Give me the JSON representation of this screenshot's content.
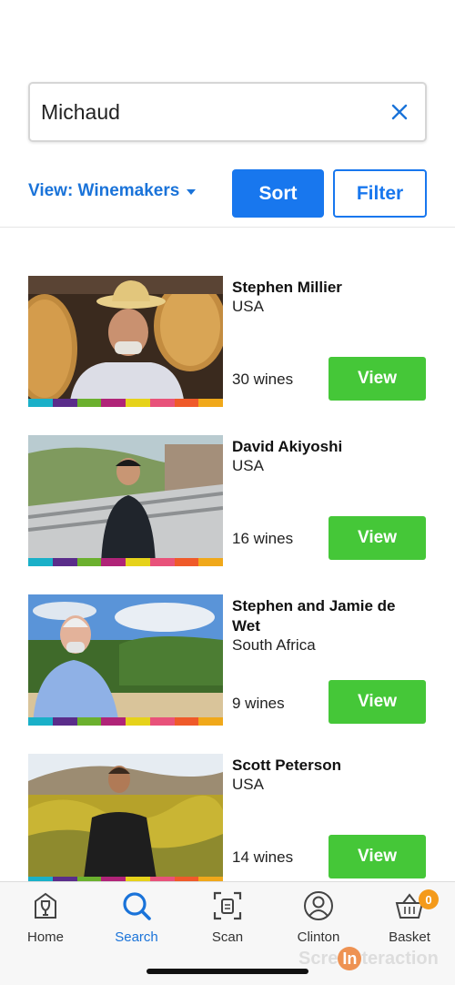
{
  "search": {
    "value": "Michaud",
    "placeholder": ""
  },
  "controls": {
    "view_label": "View: Winemakers",
    "sort_label": "Sort",
    "filter_label": "Filter"
  },
  "stripe_colors": [
    "#1ab0c8",
    "#5a2d8a",
    "#6bb02e",
    "#b02478",
    "#e6d21a",
    "#e8527a",
    "#ef5a2a",
    "#f0a81a"
  ],
  "results": [
    {
      "name": "Stephen Millier",
      "country": "USA",
      "wines": "30 wines",
      "button": "View"
    },
    {
      "name": "David Akiyoshi",
      "country": "USA",
      "wines": "16 wines",
      "button": "View"
    },
    {
      "name": "Stephen and Jamie de Wet",
      "country": "South Africa",
      "wines": "9 wines",
      "button": "View"
    },
    {
      "name": "Scott Peterson",
      "country": "USA",
      "wines": "14 wines",
      "button": "View"
    }
  ],
  "tabs": [
    {
      "label": "Home",
      "icon": "wine-glass-icon"
    },
    {
      "label": "Search",
      "icon": "search-icon"
    },
    {
      "label": "Scan",
      "icon": "scan-icon"
    },
    {
      "label": "Clinton",
      "icon": "user-icon"
    },
    {
      "label": "Basket",
      "icon": "basket-icon",
      "badge": "0"
    }
  ],
  "watermark": {
    "text_before": "Scre",
    "text_dot": "In",
    "text_after": "teraction"
  }
}
